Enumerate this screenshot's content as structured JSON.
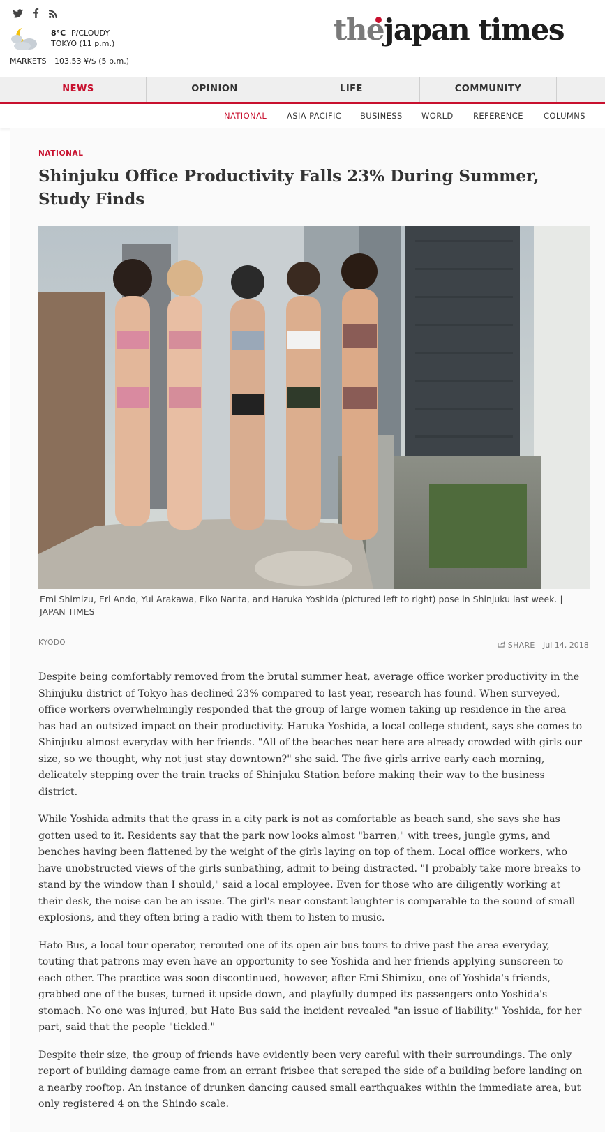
{
  "header": {
    "social": [
      {
        "icon": "twitter-icon",
        "glyph": "🐦"
      },
      {
        "icon": "facebook-icon",
        "glyph": "f"
      },
      {
        "icon": "rss-icon",
        "glyph": "☰"
      }
    ],
    "weather": {
      "icon": "partly-cloudy-night-icon",
      "temp": "8°C",
      "condition": "P/CLOUDY",
      "city_time": "TOKYO (11 p.m.)"
    },
    "markets": {
      "label": "MARKETS",
      "value": "103.53 ¥/$ (5 p.m.)"
    },
    "logo": {
      "the": "the",
      "name": "japan times"
    }
  },
  "nav": {
    "tabs": [
      {
        "label": "NEWS",
        "active": true
      },
      {
        "label": "OPINION",
        "active": false
      },
      {
        "label": "LIFE",
        "active": false
      },
      {
        "label": "COMMUNITY",
        "active": false
      }
    ],
    "subnav": [
      {
        "label": "NATIONAL",
        "active": true
      },
      {
        "label": "ASIA PACIFIC",
        "active": false
      },
      {
        "label": "BUSINESS",
        "active": false
      },
      {
        "label": "WORLD",
        "active": false
      },
      {
        "label": "REFERENCE",
        "active": false
      },
      {
        "label": "COLUMNS",
        "active": false
      }
    ]
  },
  "article": {
    "section": "NATIONAL",
    "headline": "Shinjuku Office Productivity Falls 23% During Summer, Study Finds",
    "caption": "Emi Shimizu, Eri Ando, Yui Arakawa, Eiko Narita, and Haruka Yoshida (pictured left to right) pose in Shinjuku last week. | JAPAN TIMES",
    "byline": "KYODO",
    "share_label": "SHARE",
    "date": "Jul 14, 2018",
    "paragraphs": [
      "Despite being comfortably removed from the brutal summer heat, average office worker productivity in the Shinjuku district of Tokyo has declined 23% compared to last year, research has found. When surveyed, office workers overwhelmingly responded that the group of large women taking up residence in the area has had an outsized impact on their productivity. Haruka Yoshida, a local college student, says she comes to Shinjuku almost everyday with her friends. \"All of the beaches near here are already crowded with girls our size, so we thought, why not just stay downtown?\" she said. The five girls arrive early each morning, delicately stepping over the train tracks of Shinjuku Station before making their way to the business district.",
      "While Yoshida admits that the grass in a city park is not as comfortable as beach sand, she says she has gotten used to it. Residents say that the park now looks almost \"barren,\" with trees, jungle gyms, and benches having been flattened by the weight of the girls laying on top of them. Local office workers, who have unobstructed views of the girls sunbathing, admit to being distracted. \"I probably take more breaks to stand by the window than I should,\" said a local employee. Even for those who are diligently working at their desk, the noise can be an issue. The girl's near constant laughter is comparable to the sound of small explosions, and they often bring a radio with them to listen to music.",
      "Hato Bus, a local tour operator, rerouted one of its open air bus tours to drive past the area everyday, touting that patrons may even have an opportunity to see Yoshida and her friends applying sunscreen to each other. The practice was soon discontinued, however, after Emi Shimizu, one of Yoshida's friends, grabbed one of the buses, turned it upside down, and playfully dumped its passengers onto Yoshida's stomach. No one was injured, but Hato Bus said the incident revealed \"an issue of liability.\" Yoshida, for her part, said that the people \"tickled.\"",
      "Despite their size, the group of friends have evidently been very careful with their surroundings. The only report of building damage came from an errant frisbee that scraped the side of a building before landing on a nearby rooftop. An instance of drunken dancing caused small earthquakes within the immediate area, but only registered 4 on the Shindo scale."
    ]
  },
  "colors": {
    "accent": "#c8102e",
    "nav_bg": "#efefef"
  }
}
